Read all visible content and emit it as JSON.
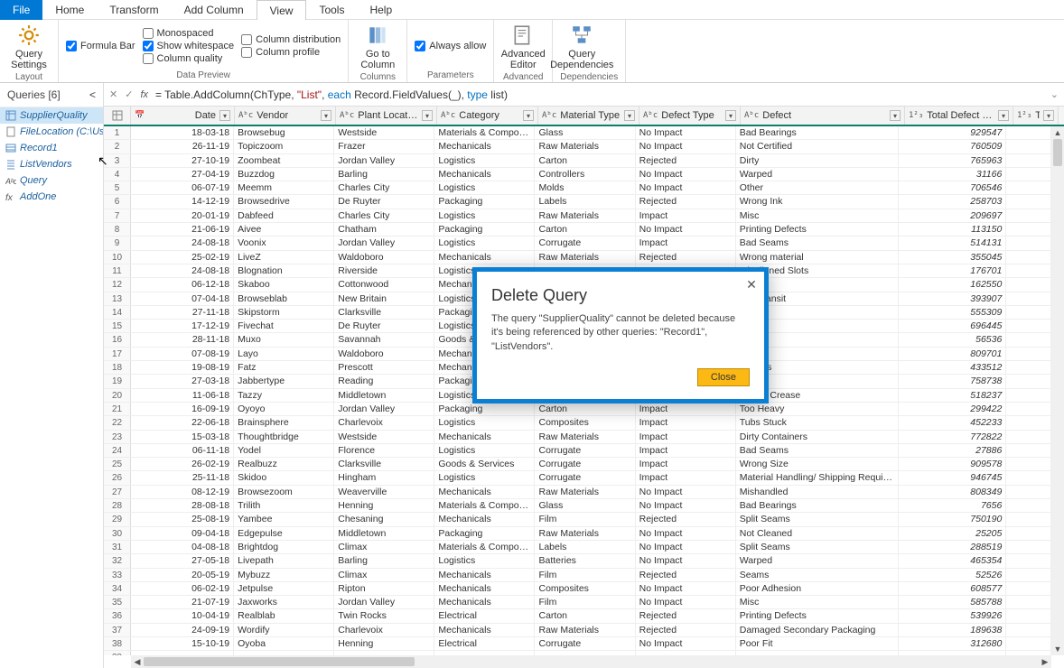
{
  "menu": {
    "file": "File",
    "home": "Home",
    "transform": "Transform",
    "addcol": "Add Column",
    "view": "View",
    "tools": "Tools",
    "help": "Help"
  },
  "ribbon": {
    "query_settings": "Query\nSettings",
    "layout": "Layout",
    "formula_bar": "Formula Bar",
    "monospaced": "Monospaced",
    "show_whitespace": "Show whitespace",
    "column_quality": "Column quality",
    "column_distribution": "Column distribution",
    "column_profile": "Column profile",
    "data_preview": "Data Preview",
    "go_to_column": "Go to\nColumn",
    "columns": "Columns",
    "always_allow": "Always allow",
    "parameters": "Parameters",
    "advanced_editor": "Advanced\nEditor",
    "advanced": "Advanced",
    "query_dependencies": "Query\nDependencies",
    "dependencies": "Dependencies"
  },
  "queries": {
    "header": "Queries [6]",
    "items": [
      {
        "name": "SupplierQuality"
      },
      {
        "name": "FileLocation (C:\\Users..."
      },
      {
        "name": "Record1"
      },
      {
        "name": "ListVendors"
      },
      {
        "name": "Query"
      },
      {
        "name": "AddOne"
      }
    ]
  },
  "formula": {
    "prefix": "= Table.AddColumn(ChType, ",
    "str1": "\"List\"",
    "mid": ", ",
    "kw1": "each",
    "mid2": " Record.FieldValues(_), ",
    "kw2": "type",
    "mid3": " list)"
  },
  "columns": [
    {
      "name": "Date",
      "type": "📅",
      "cls": "c-date"
    },
    {
      "name": "Vendor",
      "type": "Aᵇc",
      "cls": "c-vendor"
    },
    {
      "name": "Plant Location",
      "type": "Aᵇc",
      "cls": "c-plant"
    },
    {
      "name": "Category",
      "type": "Aᵇc",
      "cls": "c-cat"
    },
    {
      "name": "Material Type",
      "type": "Aᵇc",
      "cls": "c-mat"
    },
    {
      "name": "Defect Type",
      "type": "Aᵇc",
      "cls": "c-def"
    },
    {
      "name": "Defect",
      "type": "Aᵇc",
      "cls": "c-defc"
    },
    {
      "name": "Total Defect Qty",
      "type": "1²₃",
      "cls": "c-qty",
      "num": true
    },
    {
      "name": "Total Dov",
      "type": "1²₃",
      "cls": "c-dov",
      "num": true
    }
  ],
  "rows": [
    [
      "18-03-18",
      "Browsebug",
      "Westside",
      "Materials & Components",
      "Glass",
      "No Impact",
      "Bad Bearings",
      "929547",
      ""
    ],
    [
      "26-11-19",
      "Topiczoom",
      "Frazer",
      "Mechanicals",
      "Raw Materials",
      "No Impact",
      "Not Certified",
      "760509",
      ""
    ],
    [
      "27-10-19",
      "Zoombeat",
      "Jordan Valley",
      "Logistics",
      "Carton",
      "Rejected",
      "Dirty",
      "765963",
      ""
    ],
    [
      "27-04-19",
      "Buzzdog",
      "Barling",
      "Mechanicals",
      "Controllers",
      "No Impact",
      "Warped",
      "31166",
      ""
    ],
    [
      "06-07-19",
      "Meemm",
      "Charles City",
      "Logistics",
      "Molds",
      "No Impact",
      "Other",
      "706546",
      ""
    ],
    [
      "14-12-19",
      "Browsedrive",
      "De Ruyter",
      "Packaging",
      "Labels",
      "Rejected",
      "Wrong Ink",
      "258703",
      ""
    ],
    [
      "20-01-19",
      "Dabfeed",
      "Charles City",
      "Logistics",
      "Raw Materials",
      "Impact",
      "Misc",
      "209697",
      ""
    ],
    [
      "21-06-19",
      "Aivee",
      "Chatham",
      "Packaging",
      "Carton",
      "No Impact",
      "Printing Defects",
      "113150",
      ""
    ],
    [
      "24-08-18",
      "Voonix",
      "Jordan Valley",
      "Logistics",
      "Corrugate",
      "Impact",
      "Bad Seams",
      "514131",
      ""
    ],
    [
      "25-02-19",
      "LiveZ",
      "Waldoboro",
      "Mechanicals",
      "Raw Materials",
      "Rejected",
      "Wrong material",
      "355045",
      ""
    ],
    [
      "24-08-18",
      "Blognation",
      "Riverside",
      "Logistics",
      "",
      "",
      "Misaligned Slots",
      "176701",
      ""
    ],
    [
      "06-12-18",
      "Skaboo",
      "Cottonwood",
      "Mechanic",
      "",
      "",
      "Failure",
      "162550",
      ""
    ],
    [
      "07-04-18",
      "Browseblab",
      "New Britain",
      "Logistics",
      "",
      "",
      "d in Transit",
      "393907",
      ""
    ],
    [
      "27-11-18",
      "Skipstorm",
      "Clarksville",
      "Packaging",
      "",
      "",
      "ation",
      "555309",
      ""
    ],
    [
      "17-12-19",
      "Fivechat",
      "De Ruyter",
      "Logistics",
      "",
      "",
      "ck",
      "696445",
      ""
    ],
    [
      "28-11-18",
      "Muxo",
      "Savannah",
      "Goods & S",
      "",
      "",
      "ms",
      "56536",
      ""
    ],
    [
      "07-08-19",
      "Layo",
      "Waldoboro",
      "Mechanic",
      "",
      "",
      "",
      "809701",
      ""
    ],
    [
      "19-08-19",
      "Fatz",
      "Prescott",
      "Mechanic",
      "",
      "",
      "Defects",
      "433512",
      ""
    ],
    [
      "27-03-18",
      "Jabbertype",
      "Reading",
      "Packaging",
      "",
      "",
      "ects",
      "758738",
      ""
    ],
    [
      "11-06-18",
      "Tazzy",
      "Middletown",
      "Logistics",
      "Corrugate",
      "Impact",
      "Wrong Crease",
      "518237",
      ""
    ],
    [
      "16-09-19",
      "Oyoyo",
      "Jordan Valley",
      "Packaging",
      "Carton",
      "Impact",
      "Too Heavy",
      "299422",
      ""
    ],
    [
      "22-06-18",
      "Brainsphere",
      "Charlevoix",
      "Logistics",
      "Composites",
      "Impact",
      "Tubs Stuck",
      "452233",
      ""
    ],
    [
      "15-03-18",
      "Thoughtbridge",
      "Westside",
      "Mechanicals",
      "Raw Materials",
      "Impact",
      "Dirty Containers",
      "772822",
      ""
    ],
    [
      "06-11-18",
      "Yodel",
      "Florence",
      "Logistics",
      "Corrugate",
      "Impact",
      "Bad Seams",
      "27886",
      ""
    ],
    [
      "26-02-19",
      "Realbuzz",
      "Clarksville",
      "Goods & Services",
      "Corrugate",
      "Impact",
      "Wrong  Size",
      "909578",
      ""
    ],
    [
      "25-11-18",
      "Skidoo",
      "Hingham",
      "Logistics",
      "Corrugate",
      "Impact",
      "Material Handling/ Shipping Requirements Error",
      "946745",
      ""
    ],
    [
      "08-12-19",
      "Browsezoom",
      "Weaverville",
      "Mechanicals",
      "Raw Materials",
      "No Impact",
      "Mishandled",
      "808349",
      ""
    ],
    [
      "28-08-18",
      "Trilith",
      "Henning",
      "Materials & Components",
      "Glass",
      "No Impact",
      "Bad Bearings",
      "7656",
      ""
    ],
    [
      "25-08-19",
      "Yambee",
      "Chesaning",
      "Mechanicals",
      "Film",
      "Rejected",
      "Split Seams",
      "750190",
      ""
    ],
    [
      "09-04-18",
      "Edgepulse",
      "Middletown",
      "Packaging",
      "Raw Materials",
      "No Impact",
      "Not Cleaned",
      "25205",
      ""
    ],
    [
      "04-08-18",
      "Brightdog",
      "Climax",
      "Materials & Components",
      "Labels",
      "No Impact",
      "Split Seams",
      "288519",
      ""
    ],
    [
      "27-05-18",
      "Livepath",
      "Barling",
      "Logistics",
      "Batteries",
      "No Impact",
      "Warped",
      "465354",
      ""
    ],
    [
      "20-05-19",
      "Mybuzz",
      "Climax",
      "Mechanicals",
      "Film",
      "Rejected",
      "Seams",
      "52526",
      ""
    ],
    [
      "06-02-19",
      "Jetpulse",
      "Ripton",
      "Mechanicals",
      "Composites",
      "No Impact",
      "Poor  Adhesion",
      "608577",
      ""
    ],
    [
      "21-07-19",
      "Jaxworks",
      "Jordan Valley",
      "Mechanicals",
      "Film",
      "No Impact",
      "Misc",
      "585788",
      ""
    ],
    [
      "10-04-19",
      "Realblab",
      "Twin Rocks",
      "Electrical",
      "Carton",
      "Rejected",
      "Printing Defects",
      "539926",
      ""
    ],
    [
      "24-09-19",
      "Wordify",
      "Charlevoix",
      "Mechanicals",
      "Raw Materials",
      "Rejected",
      "Damaged Secondary Packaging",
      "189638",
      ""
    ],
    [
      "15-10-19",
      "Oyoba",
      "Henning",
      "Electrical",
      "Corrugate",
      "No Impact",
      "Poor Fit",
      "312680",
      ""
    ],
    [
      "",
      "",
      "",
      "",
      "",
      "",
      "",
      "",
      ""
    ]
  ],
  "dialog": {
    "title": "Delete Query",
    "body": "The query \"SupplierQuality\" cannot be deleted because it's being referenced by other queries: \"Record1\", \"ListVendors\".",
    "close": "Close"
  }
}
